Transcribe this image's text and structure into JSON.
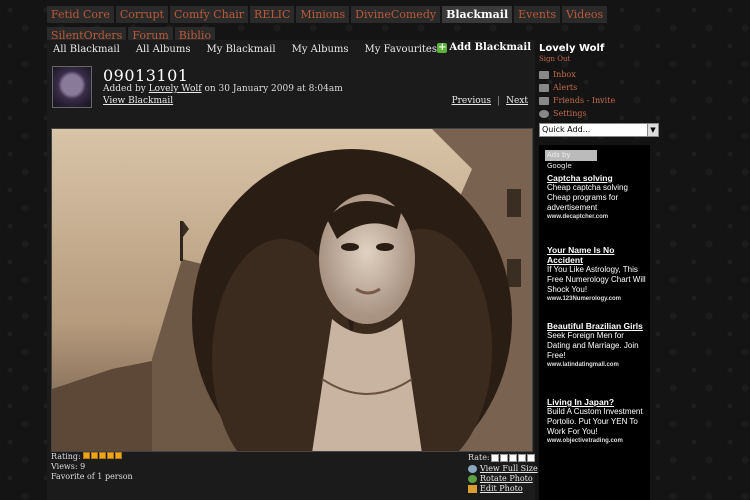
{
  "tabs": [
    "Fetid Core",
    "Corrupt",
    "Comfy Chair",
    "RELIC",
    "Minions",
    "DivineComedy",
    "Blackmail",
    "Events",
    "Videos",
    "SilentOrders",
    "Forum",
    "Biblio"
  ],
  "active_tab": "Blackmail",
  "subnav": [
    "All Blackmail",
    "All Albums",
    "My Blackmail",
    "My Albums",
    "My Favourites"
  ],
  "add_blackmail": "Add Blackmail",
  "photo": {
    "title": "09013101",
    "added_by_prefix": "Added by",
    "author": "Lovely Wolf",
    "date_text": "on 30 January 2009 at 8:04am",
    "view_blackmail": "View Blackmail",
    "previous": "Previous",
    "separator": "|",
    "next": "Next"
  },
  "stats": {
    "rating_label": "Rating:",
    "rating_stars": 5,
    "views": "Views: 9",
    "favorite": "Favorite of 1 person"
  },
  "rate": {
    "label": "Rate:",
    "boxes": 5,
    "actions": [
      "View Full Size",
      "Rotate Photo",
      "Edit Photo"
    ]
  },
  "user": {
    "name": "Lovely Wolf",
    "sign_out": "Sign Out",
    "inbox": "Inbox",
    "alerts": "Alerts",
    "friends": "Friends",
    "friends_sep": "-",
    "invite": "Invite",
    "settings": "Settings"
  },
  "quick_add": "Quick Add...",
  "ads": {
    "label": "Ads by Google",
    "items": [
      {
        "head": "Captcha solving",
        "body": "Cheap captcha solving Cheap programs for advertisement",
        "url": "www.decaptcher.com"
      },
      {
        "head": "Your Name Is No Accident",
        "body": "If You Like Astrology, This Free Numerology Chart Will Shock You!",
        "url": "www.123Numerology.com"
      },
      {
        "head": "Beautiful Brazilian Girls",
        "body": "Seek Foreign Men for Dating and Marriage. Join Free!",
        "url": "www.latindatingmall.com"
      },
      {
        "head": "Living In Japan?",
        "body": "Build A Custom Investment Portolio. Put Your YEN To Work For You!",
        "url": "www.objectivetrading.com"
      }
    ]
  },
  "colors": {
    "tab_text": "#b85a3a",
    "link_accent": "#c46a4a",
    "star": "#e7a61b",
    "sepia": "#3b2f26"
  }
}
